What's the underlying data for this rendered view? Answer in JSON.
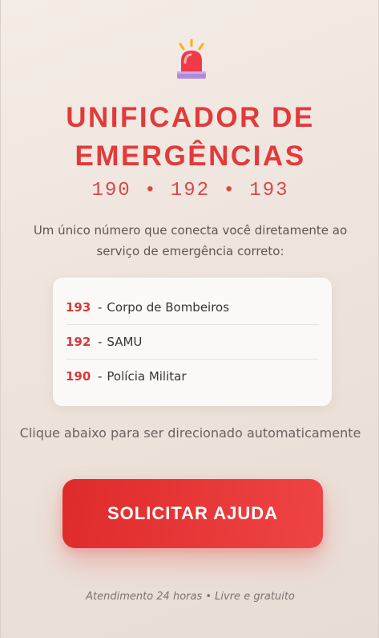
{
  "header": {
    "icon": "siren-icon",
    "title_line1": "UNIFICADOR DE",
    "title_line2": "EMERGÊNCIAS",
    "numbers": "190 • 192 • 193"
  },
  "subtitle": "Um único número que conecta você diretamente ao serviço de emergência correto:",
  "services": [
    {
      "number": "193",
      "separator": "-",
      "name": "Corpo de Bombeiros"
    },
    {
      "number": "192",
      "separator": "-",
      "name": "SAMU"
    },
    {
      "number": "190",
      "separator": "-",
      "name": "Polícia Militar"
    }
  ],
  "hint": "Clique abaixo para ser direcionado automaticamente",
  "cta": {
    "label": "SOLICITAR AJUDA"
  },
  "footer": "Atendimento 24 horas • Livre e gratuito",
  "colors": {
    "accent": "#e23a3a",
    "background": "#efe6df",
    "card": "#fbf9f7"
  }
}
